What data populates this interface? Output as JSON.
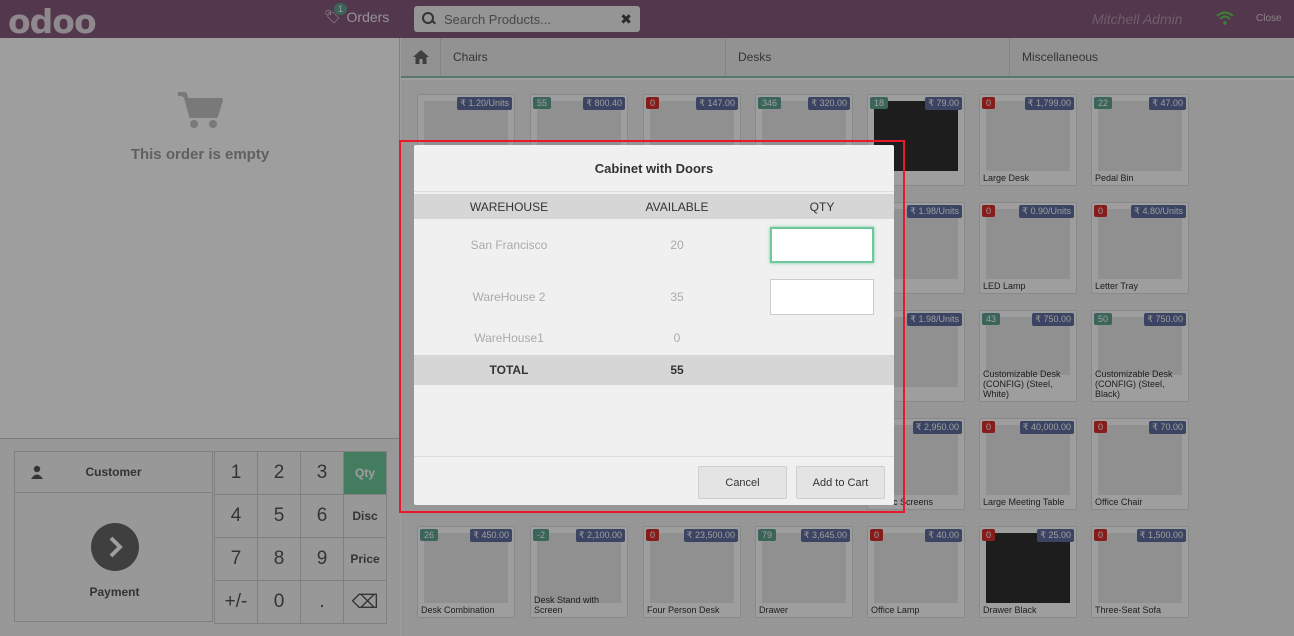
{
  "header": {
    "logo": "odoo",
    "orders_label": "Orders",
    "orders_count": "1",
    "search_placeholder": "Search Products...",
    "search_clear": "✖",
    "user": "Mitchell Admin",
    "close": "Close"
  },
  "order": {
    "empty_text": "This order is empty"
  },
  "numpad": {
    "customer": "Customer",
    "payment": "Payment",
    "keys": [
      "1",
      "2",
      "3",
      "Qty",
      "4",
      "5",
      "6",
      "Disc",
      "7",
      "8",
      "9",
      "Price",
      "+/-",
      "0",
      ".",
      "⌫"
    ]
  },
  "categories": [
    "Chairs",
    "Desks",
    "Miscellaneous"
  ],
  "products": [
    {
      "name": "",
      "price": "₹ 1.20/Units",
      "qty": ""
    },
    {
      "name": "",
      "price": "₹ 800.40",
      "qty": "55"
    },
    {
      "name": "",
      "price": "₹ 147.00",
      "qty": "0"
    },
    {
      "name": "",
      "price": "₹ 320.00",
      "qty": "346"
    },
    {
      "name": "e Box",
      "price": "₹ 79.00",
      "qty": "18"
    },
    {
      "name": "Large Desk",
      "price": "₹ 1,799.00",
      "qty": "0"
    },
    {
      "name": "Pedal Bin",
      "price": "₹ 47.00",
      "qty": "22"
    },
    {
      "name": "Pad",
      "price": "₹ 1.98/Units",
      "qty": ""
    },
    {
      "name": "LED Lamp",
      "price": "₹ 0.90/Units",
      "qty": "0"
    },
    {
      "name": "Letter Tray",
      "price": "₹ 4.80/Units",
      "qty": "0"
    },
    {
      "name": "f Unit",
      "price": "₹ 1.98/Units",
      "qty": ""
    },
    {
      "name": "Customizable Desk (CONFIG) (Steel, White)",
      "price": "₹ 750.00",
      "qty": "43"
    },
    {
      "name": "Customizable Desk (CONFIG) (Steel, Black)",
      "price": "₹ 750.00",
      "qty": "50"
    },
    {
      "name": "ic Bloc Screens",
      "price": "₹ 2,950.00",
      "qty": ""
    },
    {
      "name": "Large Meeting Table",
      "price": "₹ 40,000.00",
      "qty": "0"
    },
    {
      "name": "Office Chair",
      "price": "₹ 70.00",
      "qty": "0"
    },
    {
      "name": "Desk Combination",
      "price": "₹ 450.00",
      "qty": "26"
    },
    {
      "name": "Desk Stand with Screen",
      "price": "₹ 2,100.00",
      "qty": "-2"
    },
    {
      "name": "Four Person Desk",
      "price": "₹ 23,500.00",
      "qty": "0"
    },
    {
      "name": "Drawer",
      "price": "₹ 3,645.00",
      "qty": "79"
    },
    {
      "name": "Office Lamp",
      "price": "₹ 40.00",
      "qty": "0"
    },
    {
      "name": "Drawer Black",
      "price": "₹ 25.00",
      "qty": "0"
    },
    {
      "name": "Three-Seat Sofa",
      "price": "₹ 1,500.00",
      "qty": "0"
    }
  ],
  "dialog": {
    "title": "Cabinet with Doors",
    "headers": [
      "WAREHOUSE",
      "AVAILABLE",
      "QTY"
    ],
    "rows": [
      {
        "warehouse": "San Francisco",
        "available": "20"
      },
      {
        "warehouse": "WareHouse 2",
        "available": "35"
      },
      {
        "warehouse": "WareHouse1",
        "available": "0"
      }
    ],
    "total_label": "TOTAL",
    "total_value": "55",
    "cancel": "Cancel",
    "add": "Add to Cart"
  },
  "colors": {
    "header": "#875A7B",
    "accent": "#6ec89b",
    "highlight": "#e8192c"
  }
}
